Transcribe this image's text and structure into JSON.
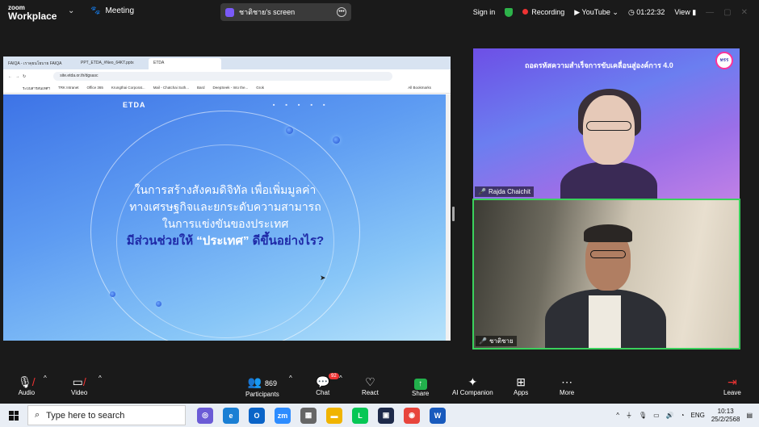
{
  "topbar": {
    "logo_line1": "zoom",
    "logo_line2": "Workplace",
    "meeting_label": "Meeting",
    "share_pill_label": "ชาติชาย's screen",
    "sign_in": "Sign in",
    "recording": "Recording",
    "youtube": "YouTube",
    "timer": "01:22:32",
    "view": "View"
  },
  "browser": {
    "tabs": [
      "FAIQA - เราคุยนโยบาย FAIQA",
      "PPT_ETDA_#Neo_64KT.pptx",
      "ETDA"
    ],
    "url": "site.etda.or.th/dgsasc",
    "bookmarks": [
      "ระบบสารสนเทศฯ",
      "TRK Intranet",
      "Office 365",
      "Krungthai Corporat...",
      "Mail - Chatchai Suth...",
      "Bard",
      "DeepSeek - Into the...",
      "Grok"
    ],
    "all_bookmarks": "All Bookmarks"
  },
  "slide": {
    "logo": "ETDA",
    "nav": "■ ■ ■ ■ ■",
    "line1": "ในการสร้างสังคมดิจิทัล เพื่อเพิ่มมูลค่า",
    "line2": "ทางเศรษฐกิจและยกระดับความสามารถ",
    "line3": "ในการแข่งขันของประเทศ",
    "highlight_pre": "มีส่วนช่วยให้ ",
    "highlight_q": "“ประเทศ”",
    "highlight_post": " ดีขึ้นอย่างไร?"
  },
  "participants_video": [
    {
      "name": "Rajda Chaichit",
      "banner": "ถอดรหัสความสำเร็จการขับเคลื่อนสู่องค์การ 4.0",
      "badge": "ทรร"
    },
    {
      "name": "ชาติชาย"
    }
  ],
  "toolbar": {
    "audio": "Audio",
    "video": "Video",
    "participants": "Participants",
    "participants_count": "869",
    "chat": "Chat",
    "chat_badge": "92",
    "react": "React",
    "share": "Share",
    "ai_companion": "AI Companion",
    "apps": "Apps",
    "more": "More",
    "leave": "Leave"
  },
  "taskbar": {
    "search_placeholder": "Type here to search",
    "lang": "ENG",
    "time": "10:13",
    "date": "25/2/2568"
  }
}
